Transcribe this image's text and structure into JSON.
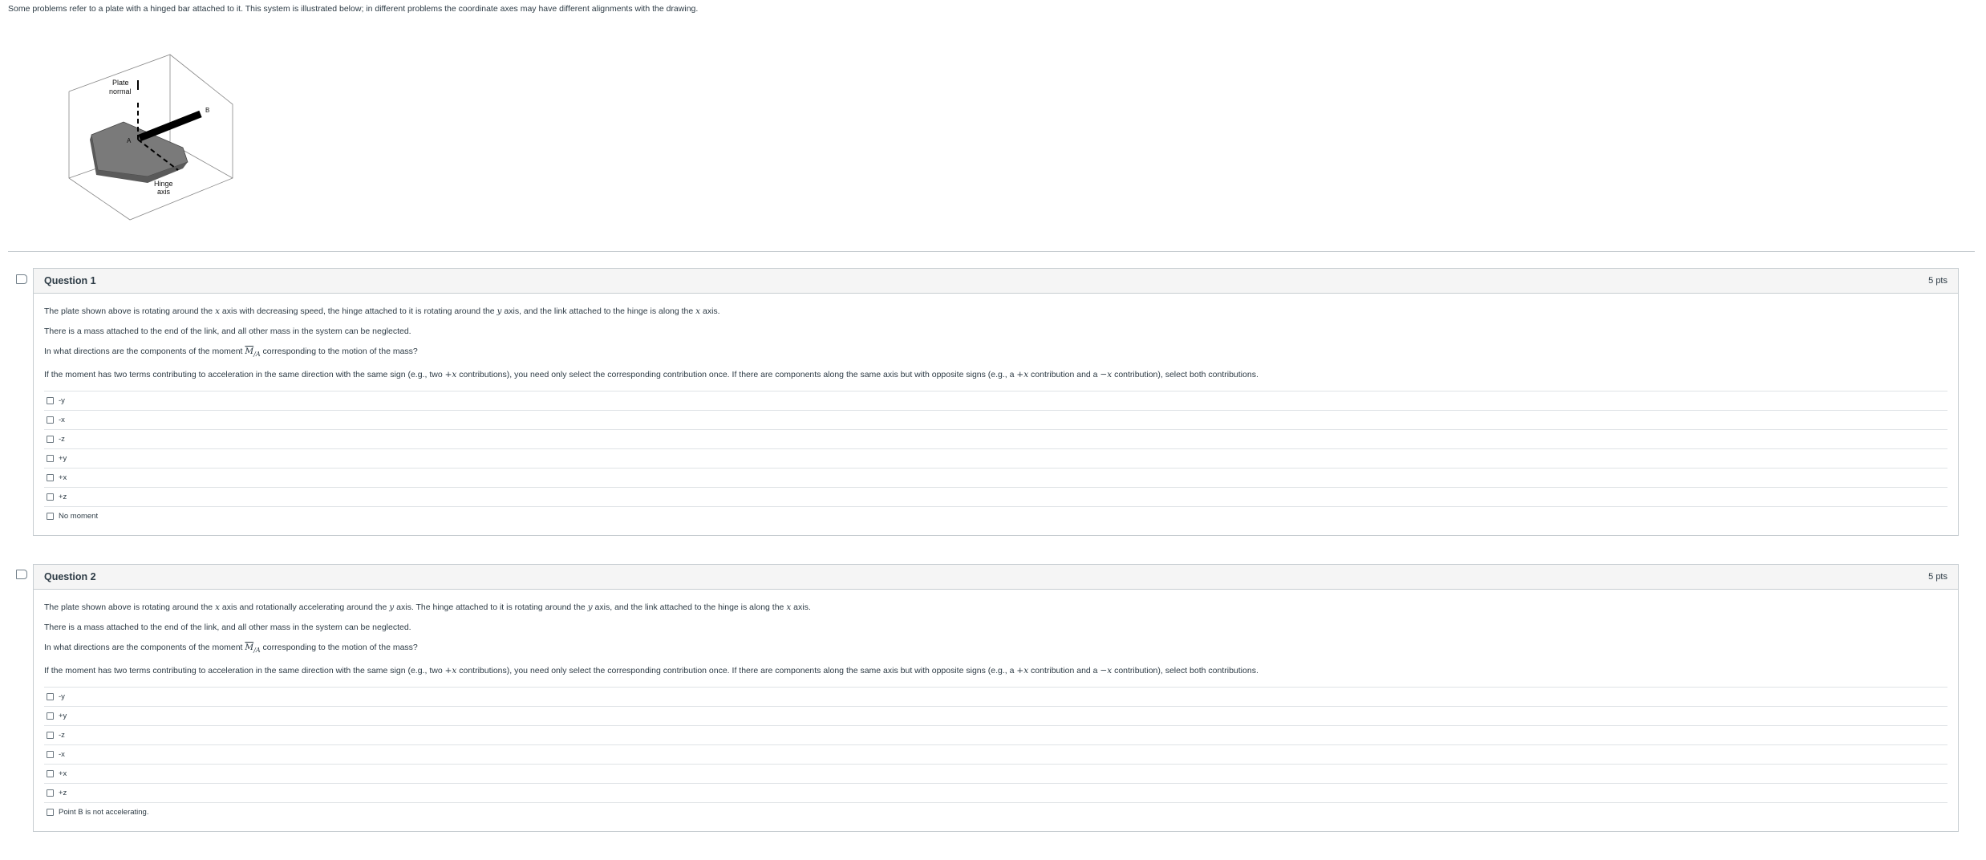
{
  "intro": "Some problems refer to a plate with a hinged bar attached to it. This system is illustrated below; in different problems the coordinate axes may have different alignments with the drawing.",
  "figure": {
    "label_plate_1": "Plate",
    "label_plate_2": "normal",
    "label_hinge_1": "Hinge",
    "label_hinge_2": "axis",
    "label_a": "A",
    "label_b": "B"
  },
  "questions": [
    {
      "title": "Question 1",
      "points": "5 pts",
      "p1a": "The plate shown above is rotating around the ",
      "p1x": "x",
      "p1b": " axis with decreasing speed, the hinge attached to it is rotating around the ",
      "p1y": "y",
      "p1c": " axis, and the link attached to the hinge is along the ",
      "p1x2": "x",
      "p1d": " axis.",
      "p2": "There is a mass attached to the end of the link, and all other mass in the system can be neglected.",
      "p3a": "In what directions are the components of the moment ",
      "p3m": "M",
      "p3s": "/A",
      "p3b": " corresponding to the motion of the mass?",
      "p4a": "If the moment has two terms contributing to acceleration in the same direction with the same sign (e.g., two ",
      "p4b": "+x",
      "p4c": " contributions), you need only select the corresponding contribution once. If there are components along the same axis but with opposite signs (e.g., a ",
      "p4d": "+x",
      "p4e": " contribution and a ",
      "p4f": "−x",
      "p4g": " contribution), select both contributions.",
      "answers": [
        "-y",
        "-x",
        "-z",
        "+y",
        "+x",
        "+z",
        "No moment"
      ]
    },
    {
      "title": "Question 2",
      "points": "5 pts",
      "p1a": "The plate shown above is rotating around the ",
      "p1x": "x",
      "p1b": " axis and rotationally accelerating around the ",
      "p1y": "y",
      "p1c": " axis. The hinge attached to it is rotating around the ",
      "p1y2": "y",
      "p1d": " axis, and the link attached to the hinge is along the ",
      "p1x2": "x",
      "p1e": " axis.",
      "p2": "There is a mass attached to the end of the link, and all other mass in the system can be neglected.",
      "p3a": "In what directions are the components of the moment ",
      "p3m": "M",
      "p3s": "/A",
      "p3b": " corresponding to the motion of the mass?",
      "p4a": "If the moment has two terms contributing to acceleration in the same direction with the same sign (e.g., two ",
      "p4b": "+x",
      "p4c": " contributions), you need only select the corresponding contribution once. If there are components along the same axis but with opposite signs (e.g., a ",
      "p4d": "+x",
      "p4e": " contribution and a ",
      "p4f": "−x",
      "p4g": " contribution), select both contributions.",
      "answers": [
        "-y",
        "+y",
        "-z",
        "-x",
        "+x",
        "+z",
        "Point B is not accelerating."
      ]
    }
  ],
  "icons": {
    "flag": "bookmark-flag-icon",
    "checkbox": "checkbox-icon"
  }
}
